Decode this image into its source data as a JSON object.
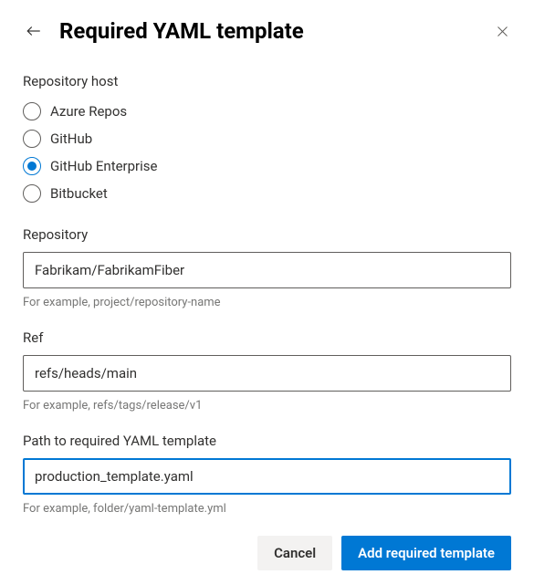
{
  "header": {
    "title": "Required YAML template"
  },
  "host": {
    "label": "Repository host",
    "options": [
      "Azure Repos",
      "GitHub",
      "GitHub Enterprise",
      "Bitbucket"
    ],
    "selected_index": 2
  },
  "repository": {
    "label": "Repository",
    "value": "Fabrikam/FabrikamFiber",
    "hint": "For example, project/repository-name"
  },
  "ref": {
    "label": "Ref",
    "value": "refs/heads/main",
    "hint": "For example, refs/tags/release/v1"
  },
  "path": {
    "label": "Path to required YAML template",
    "value": "production_template.yaml",
    "hint": "For example, folder/yaml-template.yml"
  },
  "footer": {
    "cancel": "Cancel",
    "submit": "Add required template"
  }
}
